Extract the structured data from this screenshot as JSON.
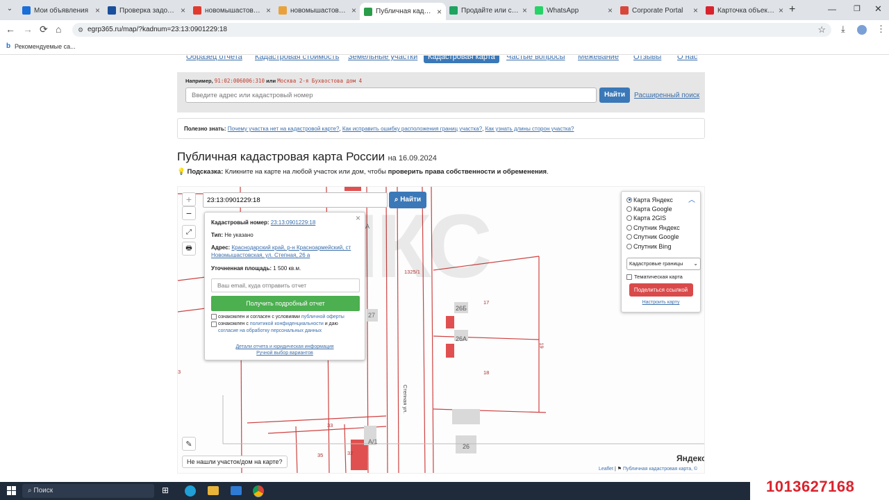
{
  "browser": {
    "tabs": [
      {
        "label": "Мои объявления",
        "icon": "avito-icon",
        "color": "#1a6fd9"
      },
      {
        "label": "Проверка задолженн",
        "icon": "p-letter-icon",
        "color": "#1a4f9c"
      },
      {
        "label": "новомышастовская",
        "icon": "yandex-icon",
        "color": "#e03b2e"
      },
      {
        "label": "новомышастовская",
        "icon": "picture-icon",
        "color": "#e9a23b"
      },
      {
        "label": "Публичная кадастр",
        "icon": "check-icon",
        "color": "#2a9d4a"
      },
      {
        "label": "Продайте или сдайт",
        "icon": "circle-icon",
        "color": "#1ea361"
      },
      {
        "label": "WhatsApp",
        "icon": "whatsapp-icon",
        "color": "#25d366"
      },
      {
        "label": "Corporate Portal",
        "icon": "portal-icon",
        "color": "#d9473a"
      },
      {
        "label": "Карточка объекта н",
        "icon": "a-letter-icon",
        "color": "#d9232d"
      }
    ],
    "url": "egrp365.ru/map/?kadnum=23:13:0901229:18",
    "bookmark": "Рекомендуемые са..."
  },
  "site": {
    "nav": [
      "Образец отчета",
      "Кадастровая стоимость",
      "Земельные участки",
      "Кадастровая карта",
      "Частые вопросы",
      "Межевание",
      "Отзывы",
      "О нас"
    ],
    "example_prefix": "Например,",
    "example_code": "91:02:006006:310",
    "example_or": "или",
    "example_address": "Москва 2-я Бухвостова дом 4",
    "search_placeholder": "Введите адрес или кадастровый номер",
    "search_button": "Найти",
    "advanced_search": "Расширенный поиск",
    "tip_label": "Полезно знать:",
    "tip_links": [
      "Почему участка нет на кадастровой карте?",
      "Как исправить ошибку расположения границ участка?",
      "Как узнать длины сторон участка?"
    ],
    "page_title": "Публичная кадастровая карта России",
    "page_date": "на 16.09.2024",
    "hint_label": "Подсказка:",
    "hint_text": "Кликните на карте на любой участок или дом, чтобы",
    "hint_bold": "проверить права собственности и обременения",
    "hint_end": "."
  },
  "map": {
    "search_value": "23:13:0901229:18",
    "search_button": "Найти",
    "watermark": "ЯКС",
    "not_found_button": "Не нашли участок/дом на карте?",
    "attribution_leaflet": "Leaflet",
    "attribution_text": "Публичная кадастровая карта, ©",
    "yandex_logo": "Яндекс",
    "labels": [
      {
        "text": "27"
      },
      {
        "text": "26Б"
      },
      {
        "text": "26А"
      },
      {
        "text": "17"
      },
      {
        "text": "18"
      },
      {
        "text": "19"
      },
      {
        "text": "33"
      },
      {
        "text": "35"
      },
      {
        "text": "32"
      },
      {
        "text": "26"
      },
      {
        "text": "1325/1"
      },
      {
        "text": "Степная ул."
      },
      {
        "text": "3"
      },
      {
        "text": "А"
      },
      {
        "text": "А/1"
      }
    ],
    "popup": {
      "kad_label": "Кадастровый номер:",
      "kad_value": "23:13:0901229:18",
      "type_label": "Тип:",
      "type_value": "Не указано",
      "addr_label": "Адрес:",
      "addr_value": "Краснодарский край, р-н Красноармейский, ст Новомышастовская, ул. Степная, 26 а",
      "area_label": "Уточненная площадь:",
      "area_value": "1 500 кв.м.",
      "email_placeholder": "Ваш email, куда отправить отчет",
      "report_button": "Получить подробный отчет",
      "agree1_pre": "ознакомлен и согласен с условиями",
      "agree1_link": "публичной оферты",
      "agree2_pre": "ознакомлен с",
      "agree2_link": "политикой конфиденциальности",
      "agree2_mid": "и даю",
      "agree2_link2": "согласие на обработку персональных данных",
      "details_link": "Детали отчета и юридическая информация",
      "manual_link": "Ручной выбор вариантов"
    },
    "layers": {
      "options": [
        "Карта Яндекс",
        "Карта Google",
        "Карта 2GIS",
        "Спутник Яндекс",
        "Спутник Google",
        "Спутник Bing"
      ],
      "selected": 0,
      "select_value": "Кадастровые границы",
      "thematic": "Тематическая карта",
      "share_button": "Поделиться ссылкой",
      "configure": "Настроить карту"
    }
  },
  "taskbar": {
    "search": "Поиск"
  },
  "phone_overlay": "1013627168"
}
